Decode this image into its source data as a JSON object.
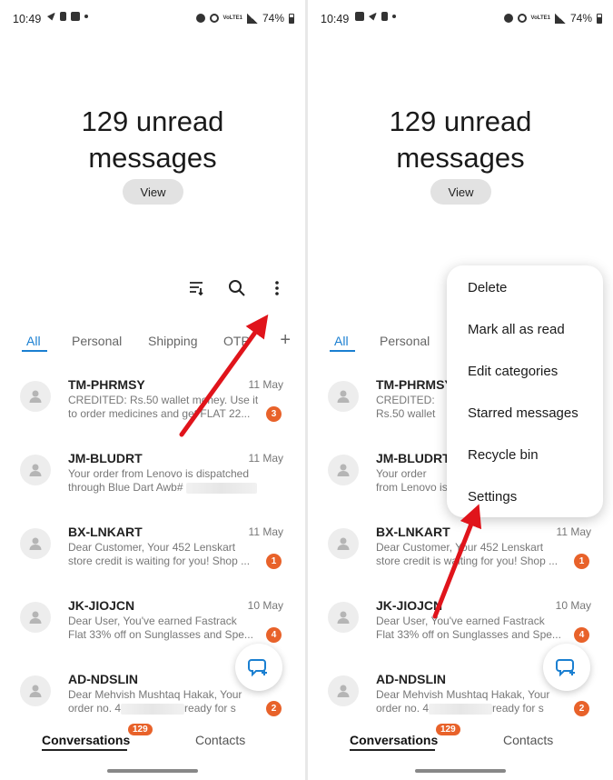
{
  "status_bar": {
    "time": "10:49",
    "battery": "74%",
    "volte": "VoLTE1"
  },
  "unread": {
    "line1": "129 unread",
    "line2": "messages",
    "view_button": "View"
  },
  "tabs": [
    "All",
    "Personal",
    "Shipping",
    "OTP"
  ],
  "conversations": [
    {
      "sender": "TM-PHRMSY",
      "date": "11 May",
      "line1": "CREDITED: Rs.50 wallet money. Use it",
      "line2": "to order medicines and get FLAT 22...",
      "badge": "3"
    },
    {
      "sender": "JM-BLUDRT",
      "date": "11 May",
      "line1": "Your order from Lenovo is dispatched",
      "line2": "through Blue Dart Awb#",
      "badge": ""
    },
    {
      "sender": "BX-LNKART",
      "date": "11 May",
      "line1": "Dear Customer, Your 452 Lenskart",
      "line2": "store credit is waiting for you! Shop ...",
      "badge": "1"
    },
    {
      "sender": "JK-JIOJCN",
      "date": "10 May",
      "line1": "Dear User,  You've earned Fastrack",
      "line2": "Flat 33% off on Sunglasses and Spe...",
      "badge": "4"
    },
    {
      "sender": "AD-NDSLIN",
      "date": "",
      "line1": "Dear Mehvish Mushtaq Hakak, Your",
      "line2": "order no. 4",
      "line2_tail": "ready for s",
      "badge": "2"
    }
  ],
  "bottom_nav": {
    "conversations": "Conversations",
    "conversations_badge": "129",
    "contacts": "Contacts"
  },
  "menu": [
    "Delete",
    "Mark all as read",
    "Edit categories",
    "Starred messages",
    "Recycle bin",
    "Settings"
  ],
  "colors": {
    "accent": "#1a7fd1",
    "badge": "#e8622a",
    "arrow": "#e0141b"
  },
  "icons": {
    "filter": "filter-icon",
    "search": "search-icon",
    "more": "more-vertical-icon",
    "add": "plus-icon",
    "compose": "compose-chat-icon",
    "contact": "person-icon"
  }
}
